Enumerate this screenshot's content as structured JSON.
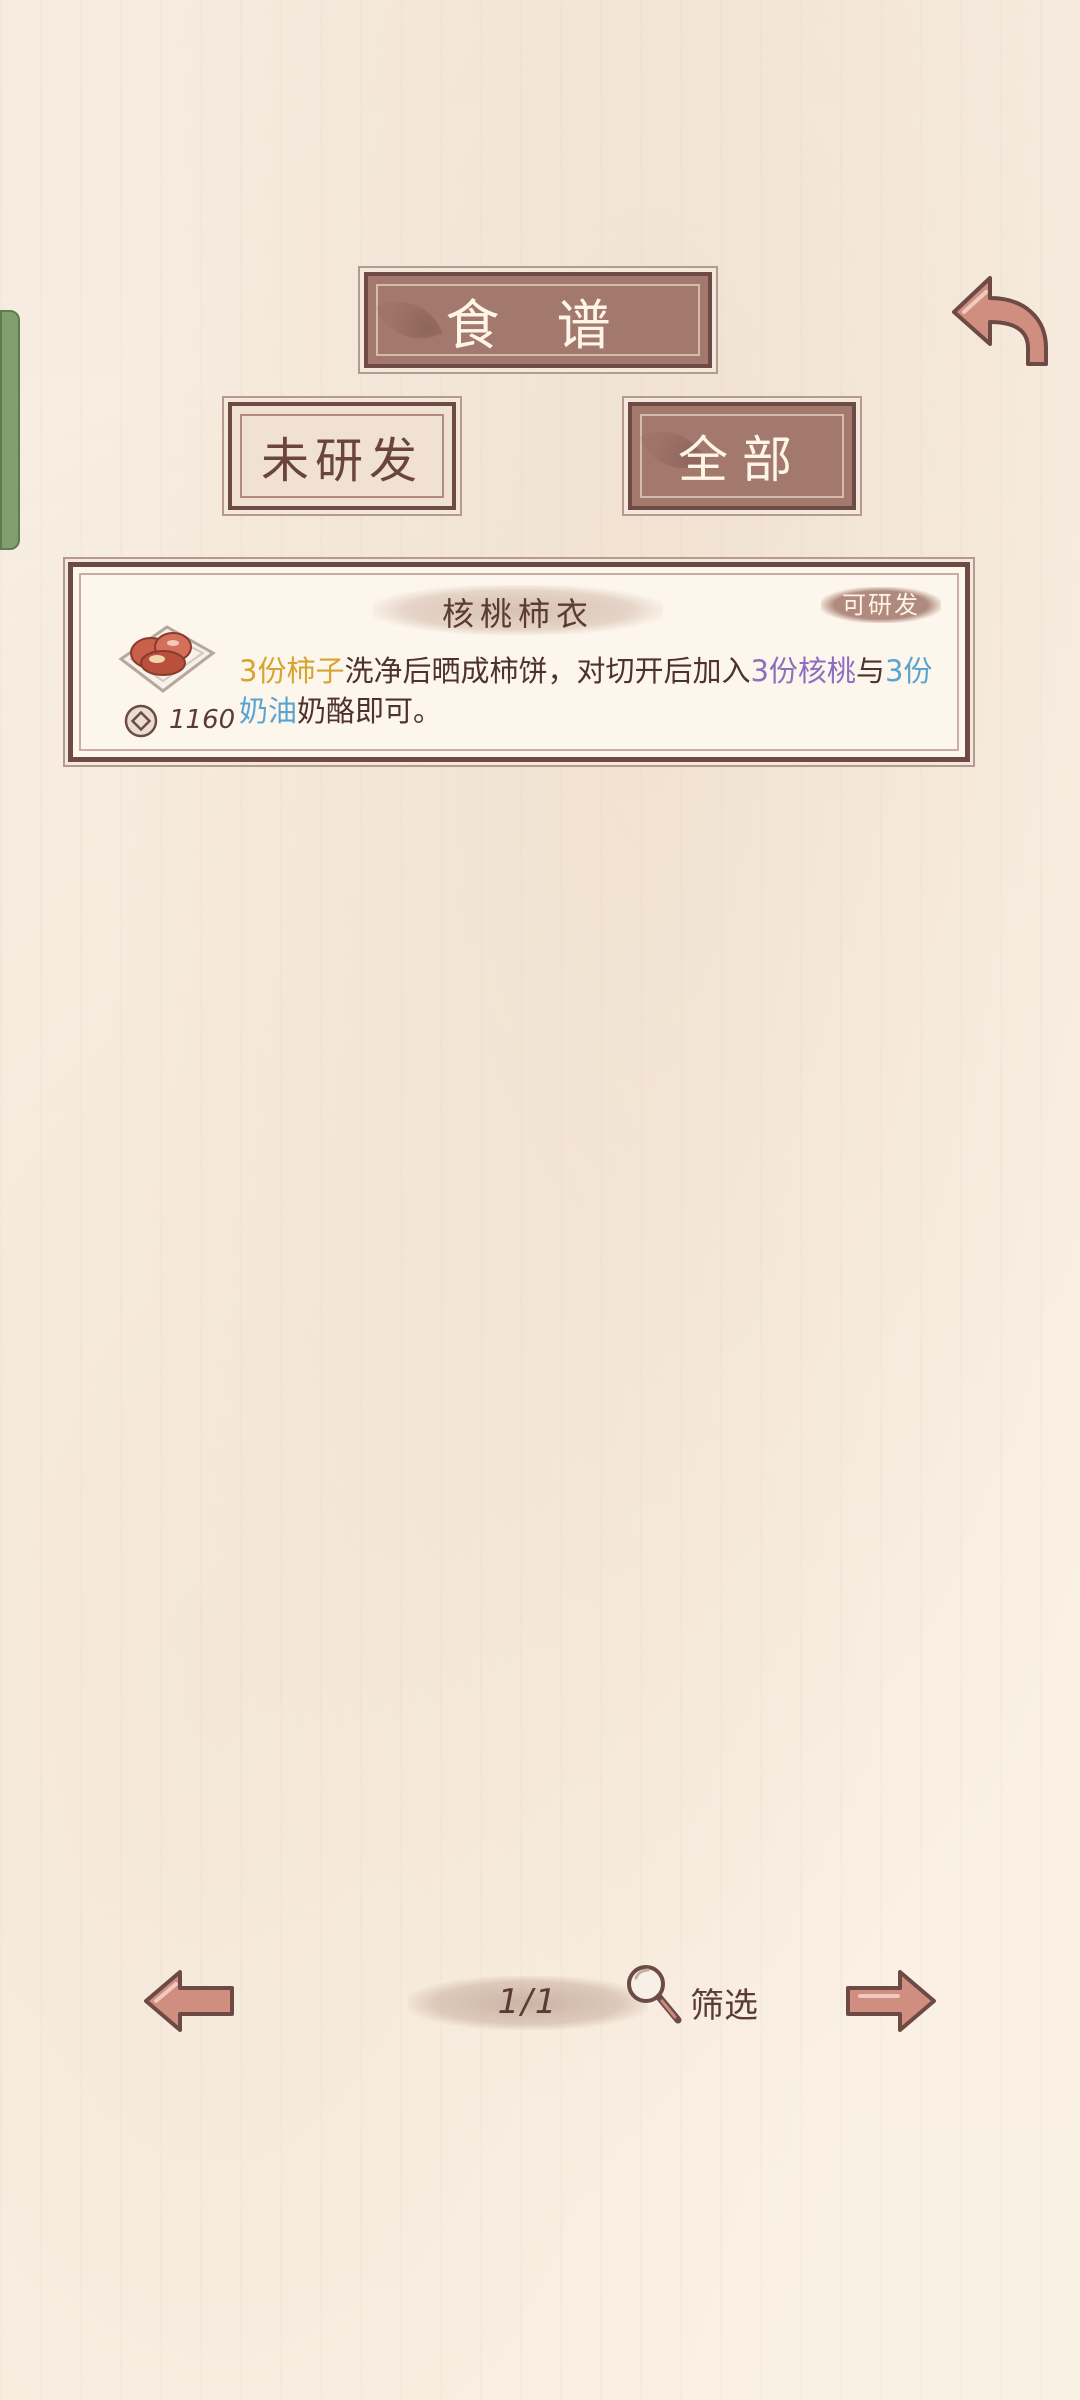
{
  "header": {
    "title": "食 谱",
    "tabs": [
      {
        "label": "未研发",
        "active": false
      },
      {
        "label": "全部",
        "active": true
      }
    ]
  },
  "recipes": [
    {
      "name": "核桃柿衣",
      "status": "可研发",
      "price": "1160",
      "icon": "persimmon-dish-icon",
      "description": [
        {
          "text": "3份柿子",
          "color": "yellow"
        },
        {
          "text": "洗净后晒成柿饼，对切开后加入",
          "color": "default"
        },
        {
          "text": "3份核桃",
          "color": "purple"
        },
        {
          "text": "与",
          "color": "default"
        },
        {
          "text": "3份奶油",
          "color": "blue"
        },
        {
          "text": "奶酪即可。",
          "color": "default"
        }
      ]
    }
  ],
  "pagination": {
    "page": "1/1",
    "filter_label": "筛选"
  },
  "colors": {
    "plaque": "#a3786d",
    "border": "#6e4a44",
    "yellow": "#d7a331",
    "purple": "#8d6fc0",
    "blue": "#5aa4d1"
  }
}
